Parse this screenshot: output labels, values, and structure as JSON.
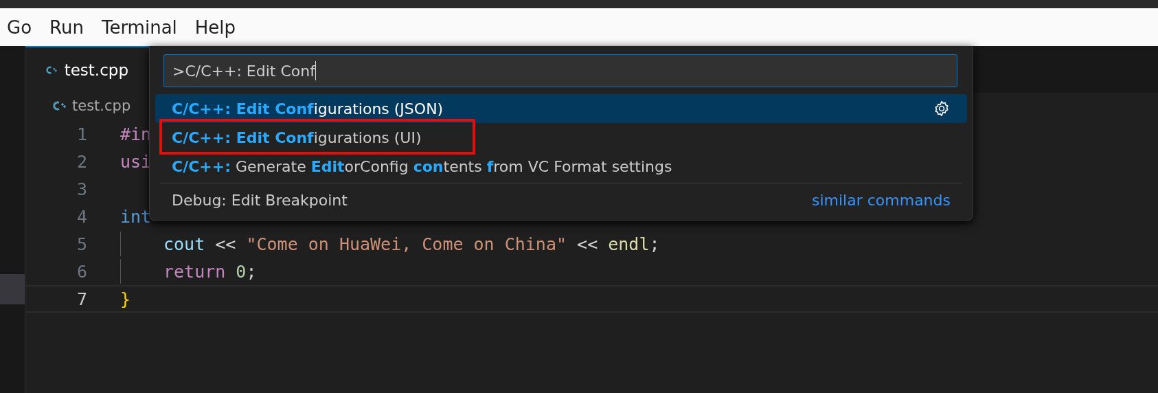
{
  "menu_bar": {
    "items": [
      "Go",
      "Run",
      "Terminal",
      "Help"
    ]
  },
  "activity_bar": {
    "items": [
      {
        "selected": false
      },
      {
        "selected": true
      }
    ]
  },
  "tabs": [
    {
      "label": "test.cpp",
      "selected": true
    }
  ],
  "breadcrumb": "test.cpp",
  "editor": {
    "lines": [
      {
        "number": "1",
        "current": false,
        "tokens": [
          {
            "kind": "directive",
            "text": "#in"
          }
        ]
      },
      {
        "number": "2",
        "current": false,
        "tokens": [
          {
            "kind": "keyword",
            "text": "usi"
          }
        ]
      },
      {
        "number": "3",
        "current": false
      },
      {
        "number": "4",
        "current": false,
        "tokens": [
          {
            "kind": "type",
            "text": "int"
          }
        ]
      },
      {
        "number": "5",
        "current": false,
        "indent": true,
        "tokens": [
          {
            "kind": "variable",
            "text": "cout"
          },
          {
            "kind": "plain",
            "text": " << "
          },
          {
            "kind": "string",
            "text": "\"Come on HuaWei, Come on China\""
          },
          {
            "kind": "plain",
            "text": " << "
          },
          {
            "kind": "function",
            "text": "endl"
          },
          {
            "kind": "plain",
            "text": ";"
          }
        ]
      },
      {
        "number": "6",
        "current": false,
        "indent": true,
        "tokens": [
          {
            "kind": "keyword",
            "text": "return"
          },
          {
            "kind": "number",
            "text": "0",
            "gap_before": true
          },
          {
            "kind": "plain",
            "text": ";"
          }
        ]
      },
      {
        "number": "7",
        "current": true,
        "tokens": [
          {
            "kind": "bracket",
            "text": "}"
          }
        ]
      }
    ]
  },
  "command_palette": {
    "input": {
      "value": ">C/C++: Edit Conf"
    },
    "items": [
      {
        "selected": true,
        "outlined": false,
        "separator": false,
        "gear": true,
        "segments": [
          {
            "text": "C/C++: Edit Conf",
            "match": true
          },
          {
            "text": "igurations (JSON)",
            "match": false
          }
        ]
      },
      {
        "selected": false,
        "outlined": true,
        "separator": false,
        "gear": false,
        "segments": [
          {
            "text": "C/C++: Edit Conf",
            "match": true
          },
          {
            "text": "igurations (UI)",
            "match": false
          }
        ]
      },
      {
        "selected": false,
        "outlined": false,
        "separator": false,
        "gear": false,
        "segments": [
          {
            "text": "C/C++:",
            "match": true
          },
          {
            "text": " Generate ",
            "match": false
          },
          {
            "text": "Edit",
            "match": true
          },
          {
            "text": "orConfig ",
            "match": false
          },
          {
            "text": "con",
            "match": true
          },
          {
            "text": "tents ",
            "match": false
          },
          {
            "text": "f",
            "match": true
          },
          {
            "text": "rom VC Format settings",
            "match": false
          }
        ]
      },
      {
        "selected": false,
        "outlined": false,
        "separator": true,
        "gear": false,
        "link": "similar commands",
        "segments": [
          {
            "text": "Debug: Edit Breakpoint",
            "match": false
          }
        ]
      }
    ]
  }
}
